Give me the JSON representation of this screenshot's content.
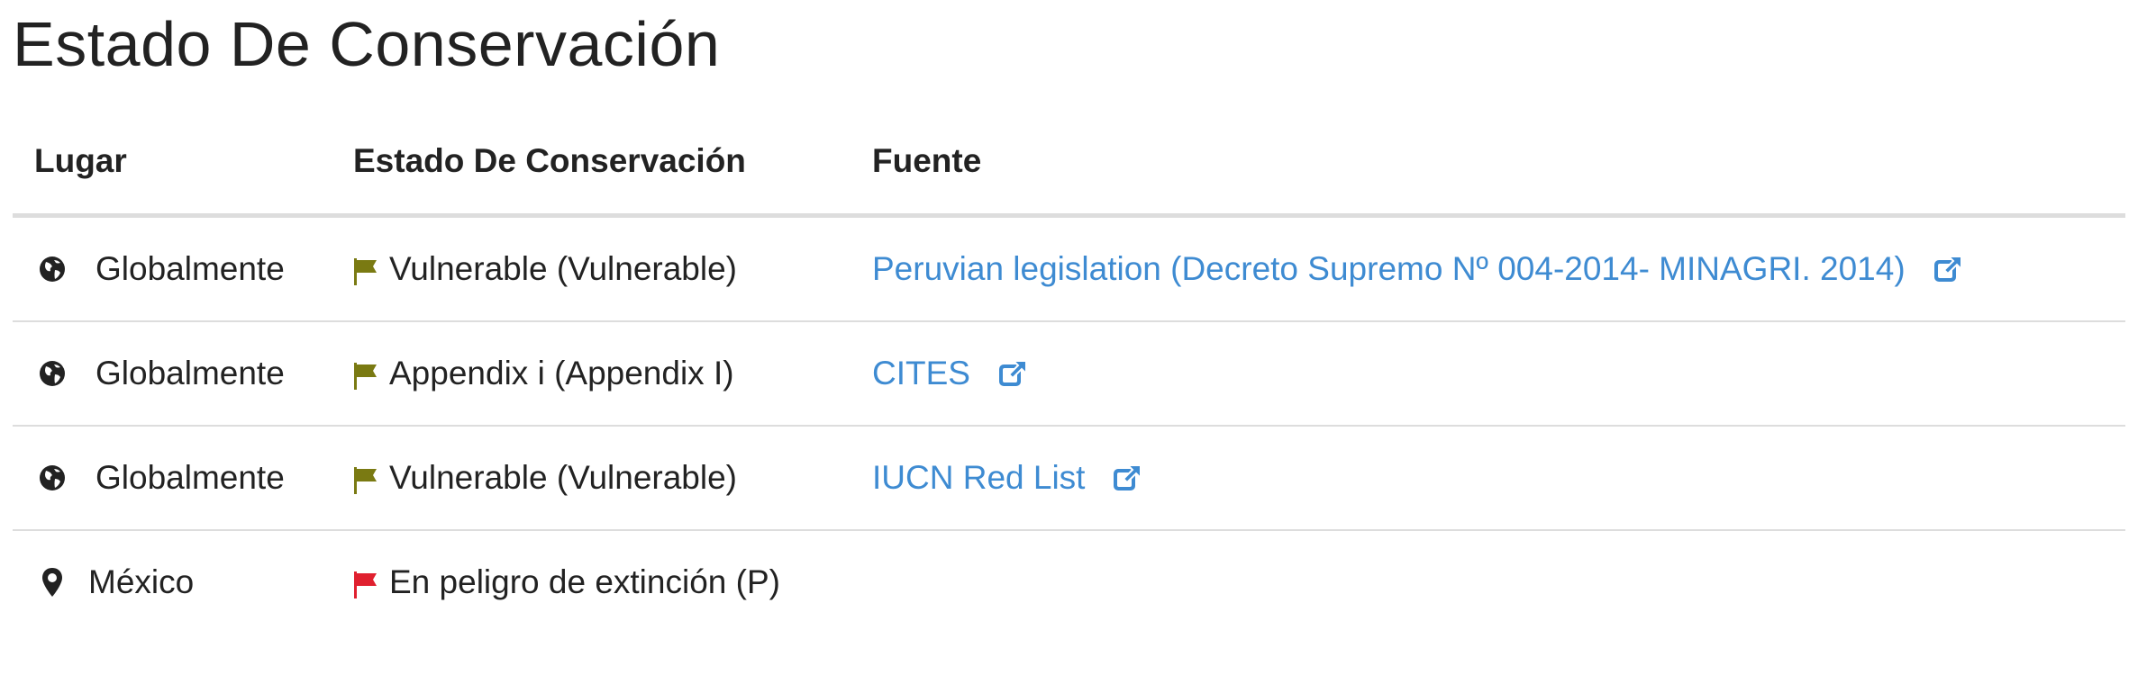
{
  "page_title": "Estado De Conservación",
  "table": {
    "headers": {
      "place": "Lugar",
      "status": "Estado De Conservación",
      "source": "Fuente"
    },
    "rows": [
      {
        "place": "Globalmente",
        "place_icon": "globe-icon",
        "status": "Vulnerable (Vulnerable)",
        "flag_color": "#7a7a12",
        "source": "Peruvian legislation (Decreto Supremo Nº 004-2014- MINAGRI. 2014)"
      },
      {
        "place": "Globalmente",
        "place_icon": "globe-icon",
        "status": "Appendix i (Appendix I)",
        "flag_color": "#7a7a12",
        "source": "CITES"
      },
      {
        "place": "Globalmente",
        "place_icon": "globe-icon",
        "status": "Vulnerable (Vulnerable)",
        "flag_color": "#7a7a12",
        "source": "IUCN Red List"
      },
      {
        "place": "México",
        "place_icon": "map-marker-icon",
        "status": "En peligro de extinción (P)",
        "flag_color": "#e0202f",
        "source": ""
      }
    ]
  },
  "colors": {
    "link": "#3e8bd2",
    "divider": "#dddddd",
    "text": "#222222"
  }
}
